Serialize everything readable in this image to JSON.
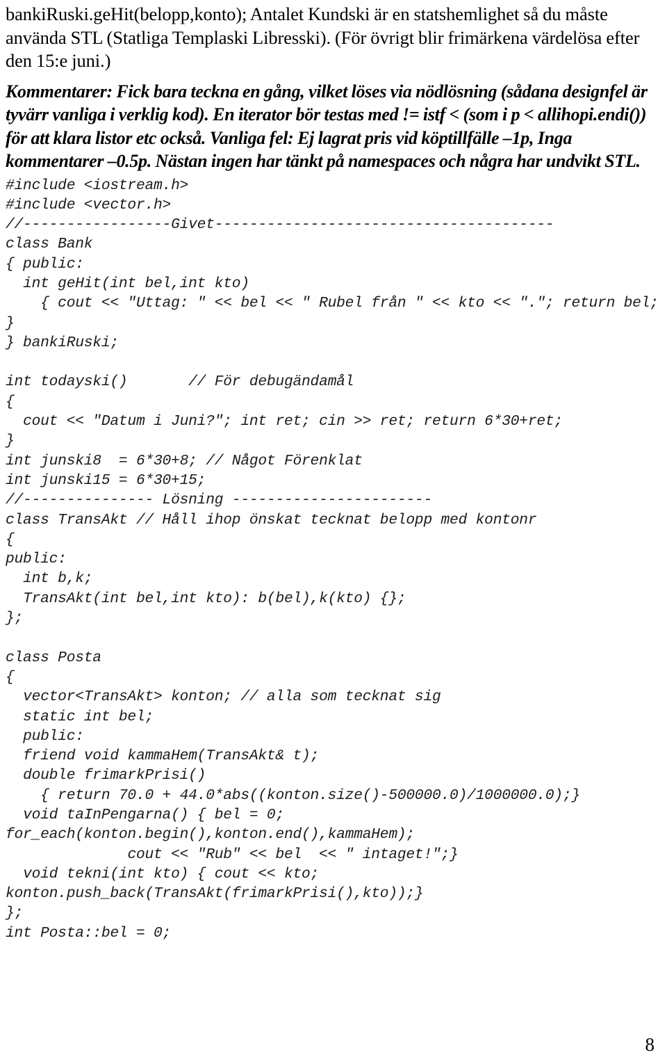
{
  "document": {
    "page_number": "8",
    "intro_paragraph": "bankiRuski.geHit(belopp,konto); Antalet Kundski är en statshemlighet så du måste använda STL (Statliga Templaski Libresski). (För övrigt blir frimärkena värdelösa efter den 15:e juni.)",
    "comment_paragraph": "Kommentarer: Fick bara teckna en gång, vilket löses via nödlösning (sådana designfel är tyvärr vanliga i verklig kod). En iterator bör testas med != istf < (som i p < allihopi.endi()) för att klara listor etc också. Vanliga fel: Ej lagrat pris vid köptillfälle –1p, Inga kommentarer –0.5p. Nästan ingen har tänkt på namespaces och några har undvikt STL.",
    "code_listing": "#include <iostream.h>\n#include <vector.h>\n//-----------------Givet---------------------------------------\nclass Bank\n{ public:\n  int geHit(int bel,int kto)\n    { cout << \"Uttag: \" << bel << \" Rubel från \" << kto << \".\"; return bel; }\n} bankiRuski;\n\nint todayski()       // För debugändamål\n{\n  cout << \"Datum i Juni?\"; int ret; cin >> ret; return 6*30+ret;\n}\nint junski8  = 6*30+8; // Något Förenklat\nint junski15 = 6*30+15;\n//--------------- Lösning -----------------------\nclass TransAkt // Håll ihop önskat tecknat belopp med kontonr\n{\npublic:\n  int b,k;\n  TransAkt(int bel,int kto): b(bel),k(kto) {};\n};\n\nclass Posta\n{\n  vector<TransAkt> konton; // alla som tecknat sig\n  static int bel;\n  public:\n  friend void kammaHem(TransAkt& t);\n  double frimarkPrisi()\n    { return 70.0 + 44.0*abs((konton.size()-500000.0)/1000000.0);}\n  void taInPengarna() { bel = 0; for_each(konton.begin(),konton.end(),kammaHem);\n              cout << \"Rub\" << bel  << \" intaget!\";}\n  void tekni(int kto) { cout << kto; konton.push_back(TransAkt(frimarkPrisi(),kto));}\n};\nint Posta::bel = 0;"
  }
}
